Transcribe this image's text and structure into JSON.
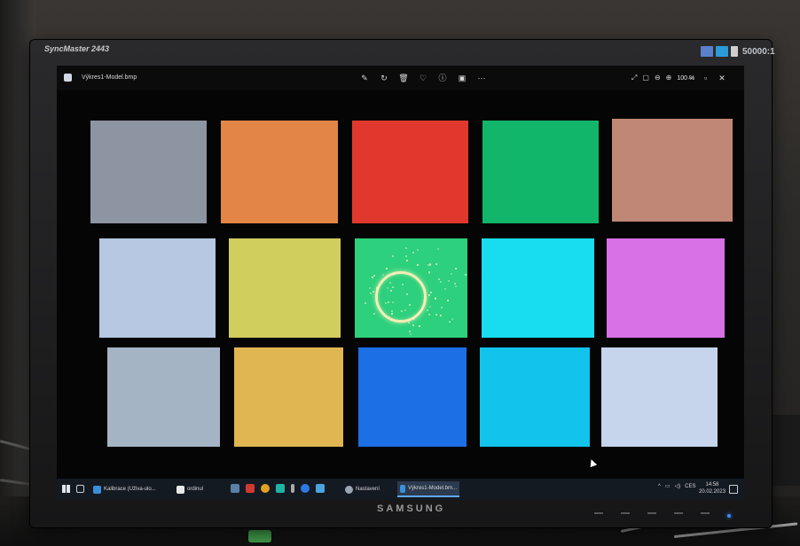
{
  "monitor": {
    "model_label": "SyncMaster 2443",
    "brand_label": "SAMSUNG",
    "contrast_label": "50000:1"
  },
  "viewer": {
    "title": "Výkres1-Model.bmp",
    "zoom": "100 %"
  },
  "swatch_colors": [
    [
      "#8d95a3",
      "#e48548",
      "#e0382c",
      "#12b66a",
      "#c08776"
    ],
    [
      "#b6c8e2",
      "#d0ce5d",
      "#2dd07c",
      "#18dcef",
      "#d871e6"
    ],
    [
      "#a5b4c4",
      "#e0b653",
      "#1c6fe4",
      "#12c3ec",
      "#c6d5ec"
    ]
  ],
  "taskbar": {
    "items": [
      {
        "label": "Kalibrace (Uživa-ulo...",
        "color": "#3a8fd8"
      },
      {
        "label": "ordinul",
        "color": "#e8e8e8"
      },
      {
        "label": "Nastavení",
        "color": "#9aa6b3"
      },
      {
        "label": "Výkres1-Model.bm...",
        "color": "#3a8fd8"
      }
    ],
    "tray_lang": "CES",
    "time": "14:58",
    "date": "20.02.2023"
  }
}
